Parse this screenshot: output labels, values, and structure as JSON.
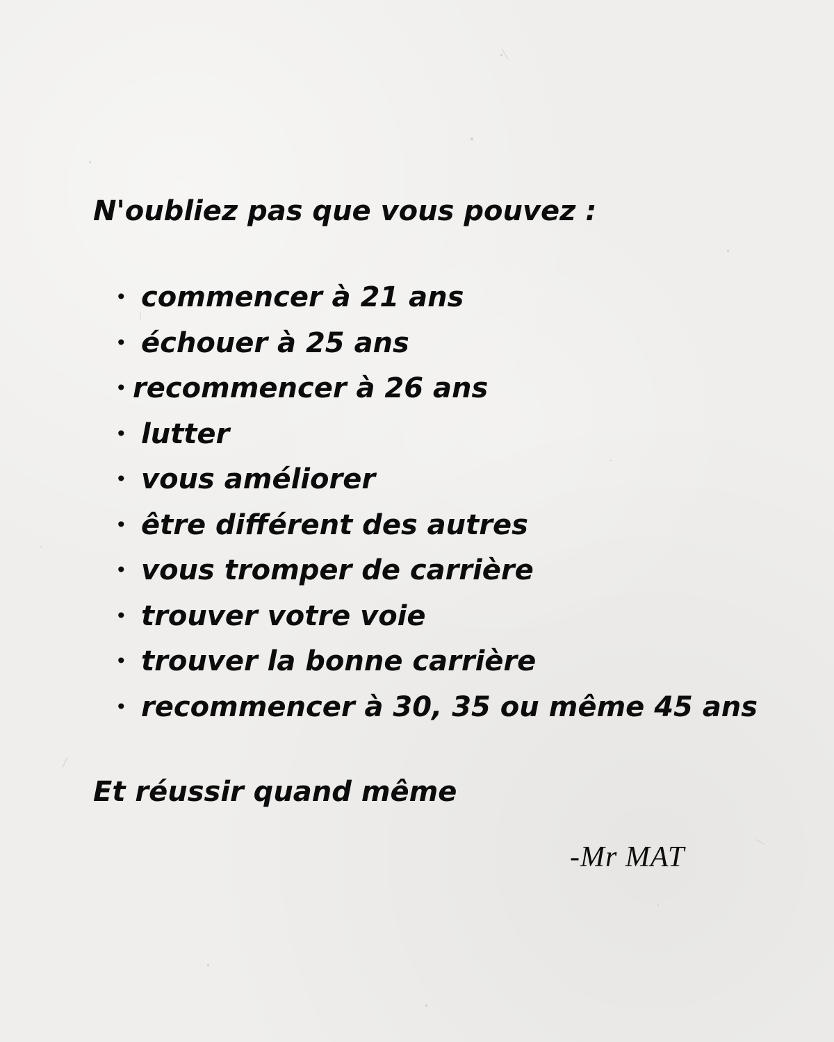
{
  "heading": "N'oubliez pas que vous pouvez :",
  "list": {
    "bullet": "•",
    "items": [
      "commencer à 21 ans",
      "échouer à 25 ans",
      "recommencer à 26 ans",
      "lutter",
      "vous améliorer",
      "être différent des autres",
      "vous tromper de carrière",
      "trouver votre voie",
      "trouver la bonne carrière",
      "recommencer à 30, 35 ou même 45 ans"
    ]
  },
  "closing": "Et réussir quand même",
  "signature": "-Mr MAT",
  "colors": {
    "paper": "#efeeec",
    "ink": "#0c0c0c"
  }
}
